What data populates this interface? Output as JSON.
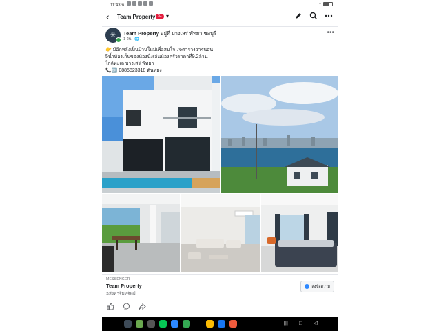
{
  "status_bar": {
    "time": "11:43 น."
  },
  "header": {
    "title": "Team Property",
    "badge": "9+",
    "caret": "▾",
    "icons": [
      "back-arrow-icon",
      "edit-icon",
      "search-icon",
      "more-icon"
    ]
  },
  "post": {
    "author": "Team Property",
    "location": "อยู่ที่ บางเสร่ พัทยา ชลบุรี",
    "meta": "1 วัน · 🌐",
    "lines": [
      "👉 มีอีกหลังเป็นบ้านใหม่เพื่อสนใจ 76ตารางวา4นอน",
      "5น้ำห้องเก็บของห้องนั่งเล่นห้องครัวราคาที่9.2ล้าน",
      "ใกล้ทะเล บางเสร่ พัทยา",
      "📞🆗 0885823318 ต้นหยง"
    ],
    "photos": [
      "house-exterior-photo",
      "sea-view-photo",
      "living-area-photo",
      "living-room-photo",
      "bedroom-photo"
    ]
  },
  "messenger_card": {
    "label": "MESSENGER",
    "name": "Team Property",
    "subtitle": "อสังหาริมทรัพย์",
    "send_label": "ส่งข้อความ"
  },
  "colors": {
    "accent": "#1877f2",
    "badge": "#e41e3f",
    "online": "#31a24c"
  }
}
